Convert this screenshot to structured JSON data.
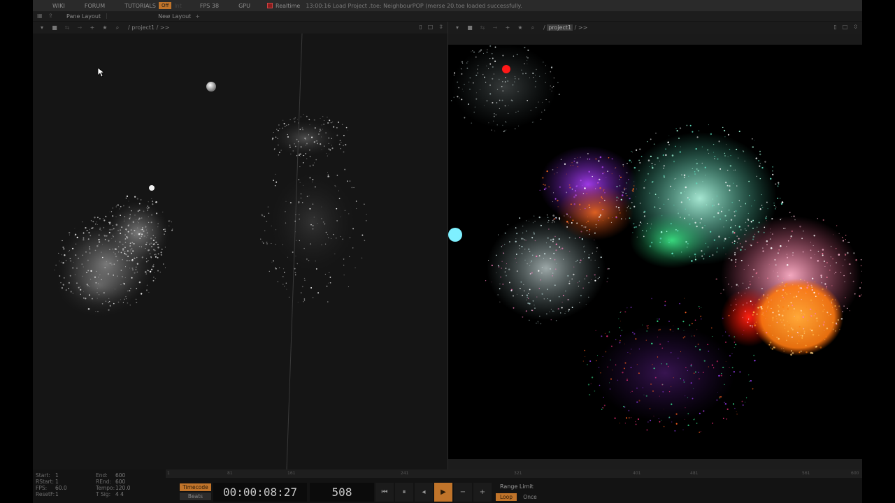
{
  "menu": {
    "items": [
      "WIKI",
      "FORUM",
      "TUTORIALS"
    ],
    "off_label": "Off",
    "ghost_label": "Int",
    "fps_label": "FPS 38",
    "gpu_label": "GPU",
    "realtime_label": "Realtime",
    "status": "13:00:16 Load Project .toe: NeighbourPOP (merse 20.toe loaded successfully."
  },
  "layout": {
    "pane_layout": "Pane Layout",
    "new_layout": "New Layout"
  },
  "left_pane": {
    "path": "/ project1 / >>"
  },
  "right_pane": {
    "root": "/",
    "path_hl": "project1",
    "path_tail": "/ >>"
  },
  "ruler": [
    "1",
    "81",
    "161",
    "241",
    "321",
    "401",
    "481",
    "561",
    "600"
  ],
  "info": {
    "start_k": "Start:",
    "start_v": "1",
    "end_k": "End:",
    "end_v": "600",
    "rstart_k": "RStart:",
    "rstart_v": "1",
    "rend_k": "REnd:",
    "rend_v": "600",
    "fps_k": "FPS:",
    "fps_v": "60.0",
    "tempo_k": "Tempo:",
    "tempo_v": "120.0",
    "reset_k": "ResetF:",
    "reset_v": "1",
    "tsig_k": "T Sig:",
    "tsig_v": "4    4"
  },
  "transport": {
    "timecode_label": "Timecode",
    "beats_label": "Beats",
    "timecode": "00:00:08:27",
    "frame": "508",
    "range_limit": "Range Limit",
    "loop": "Loop",
    "once": "Once"
  },
  "colors": {
    "accent": "#c0742a"
  }
}
